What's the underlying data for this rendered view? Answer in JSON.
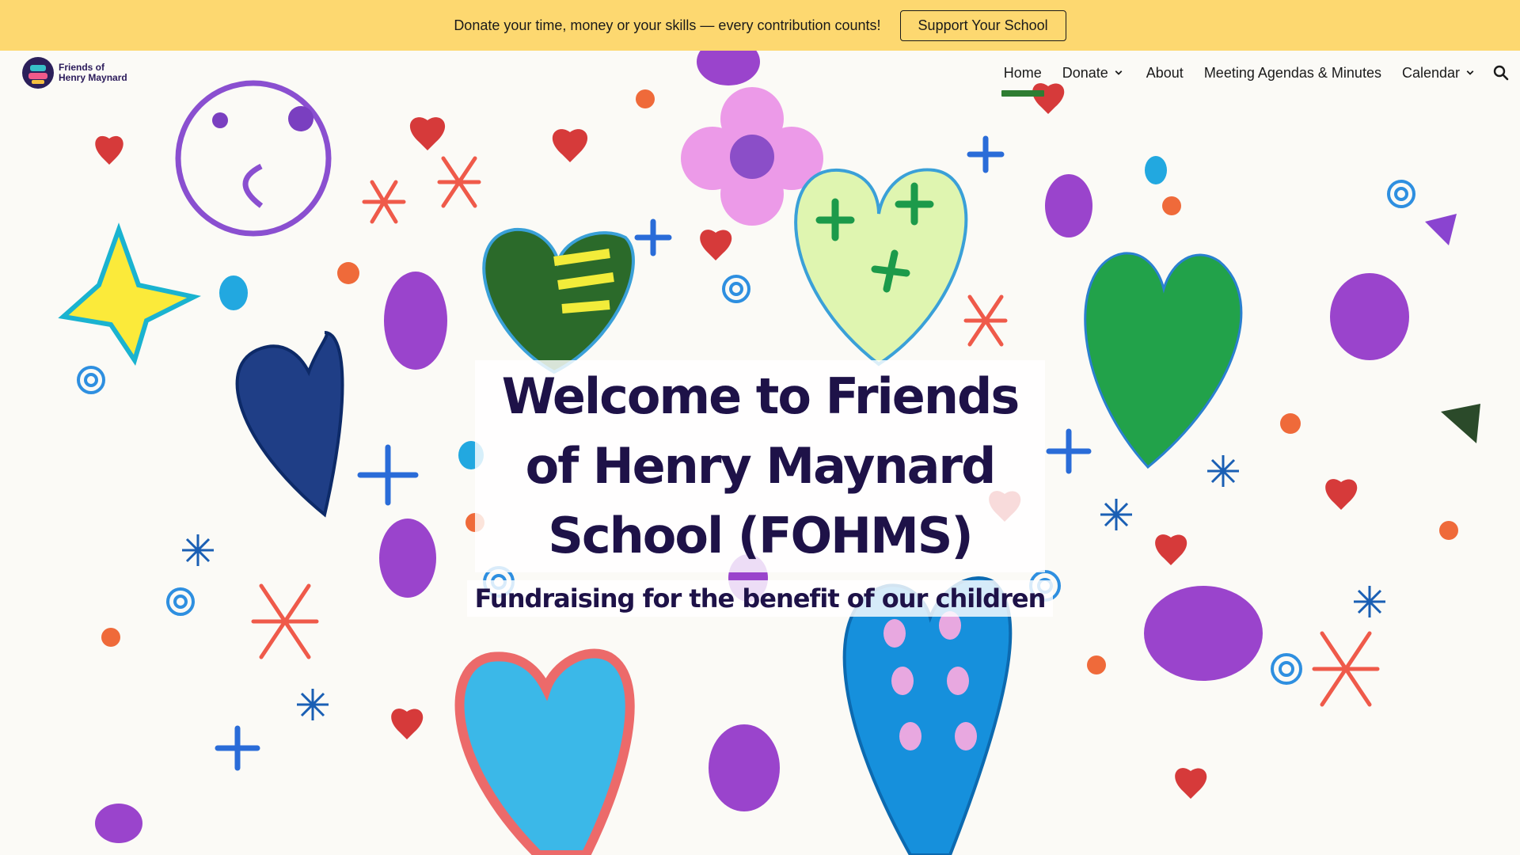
{
  "banner": {
    "text": "Donate your time, money or your skills — every contribution counts!",
    "button_label": "Support Your School",
    "color": "#fdd870"
  },
  "header": {
    "logo_line1": "Friends of",
    "logo_line2": "Henry Maynard",
    "nav": [
      {
        "label": "Home",
        "active": true
      },
      {
        "label": "Donate",
        "dropdown": true
      },
      {
        "label": "About"
      },
      {
        "label": "Meeting Agendas & Minutes"
      },
      {
        "label": "Calendar",
        "dropdown": true
      }
    ],
    "active_color": "#2e7d32",
    "search_icon": "search-icon"
  },
  "hero": {
    "title": "Welcome to Friends of Henry Maynard School (FOHMS)",
    "subtitle": "Fundraising for the benefit of our children",
    "text_color": "#1e1248"
  }
}
